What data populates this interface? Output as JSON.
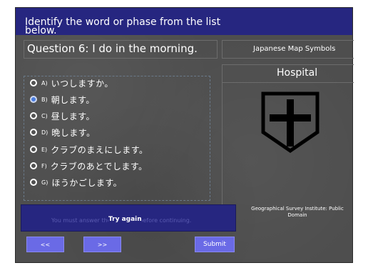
{
  "header": {
    "instruction": "Identify the word or phase from the list below."
  },
  "question": {
    "text": "Question 6:  I do in the morning."
  },
  "options": [
    {
      "letter": "A)",
      "text": "いつしますか。",
      "selected": false
    },
    {
      "letter": "B)",
      "text": "朝します。",
      "selected": true
    },
    {
      "letter": "C)",
      "text": "昼します。",
      "selected": false
    },
    {
      "letter": "D)",
      "text": "晩します。",
      "selected": false
    },
    {
      "letter": "E)",
      "text": "クラブのまえにします。",
      "selected": false
    },
    {
      "letter": "F)",
      "text": "クラブのあとでします。",
      "selected": false
    },
    {
      "letter": "G)",
      "text": "ほうかごします。",
      "selected": false
    }
  ],
  "side_panel": {
    "title": "Japanese Map Symbols",
    "label": "Hospital",
    "icon": "hospital-map-symbol-icon",
    "credit": "Geographical Survey Institute: Public Domain"
  },
  "feedback": {
    "hint": "You must answer the question before continuing.",
    "message": "Try again"
  },
  "nav": {
    "prev_label": "<<",
    "next_label": ">>",
    "submit_label": "Submit"
  },
  "colors": {
    "header_bg": "#262680",
    "panel_bg": "#4e4e4e",
    "button_bg": "#6a6ae6",
    "selected_radio": "#4a7de0"
  }
}
